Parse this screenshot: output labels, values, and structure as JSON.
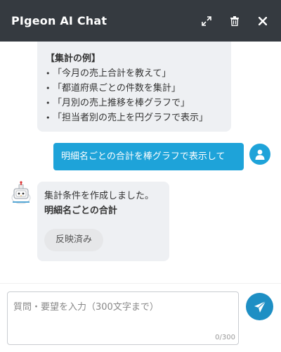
{
  "header": {
    "title": "PIgeon AI Chat",
    "icons": [
      "expand-icon",
      "trash-icon",
      "close-icon"
    ],
    "background": "#353a40"
  },
  "messages": {
    "examples": {
      "title": "【集計の例】",
      "items": [
        "「今月の売上合計を教えて」",
        "「都道府県ごとの件数を集計」",
        "「月別の売上推移を棒グラフで」",
        "「担当者別の売上を円グラフで表示」"
      ]
    },
    "user_message": "明細名ごとの合計を棒グラフで表示して",
    "bot_reply": {
      "line1": "集計条件を作成しました。",
      "line2": "明細名ごとの合計",
      "reflected_label": "反映済み"
    }
  },
  "input": {
    "placeholder": "質問・要望を入力（300文字まで）",
    "value": "",
    "char_count": "0/300"
  },
  "colors": {
    "accent": "#1ea3d9",
    "send": "#1e8fc4",
    "bubble_bot": "#eef0f3"
  }
}
